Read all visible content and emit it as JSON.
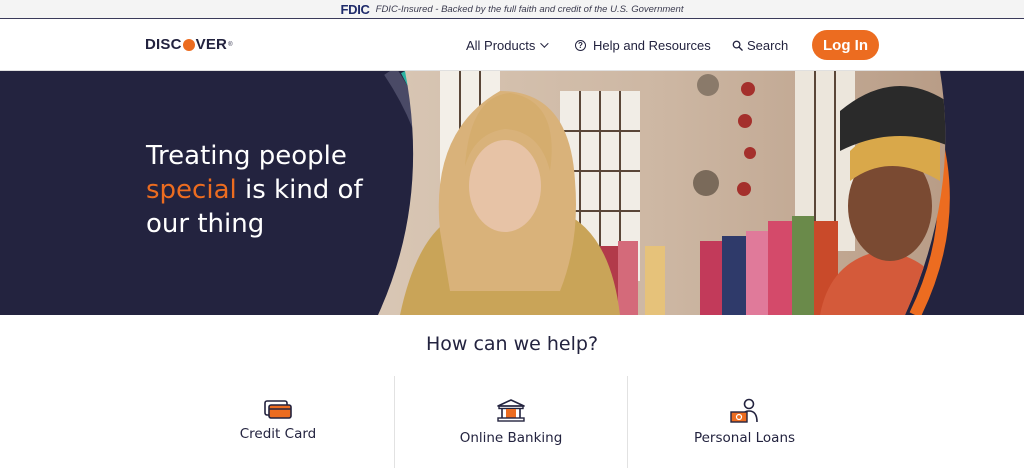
{
  "fdic_bar": {
    "logo": "FDIC",
    "text": "FDIC-Insured - Backed by the full faith and credit of the U.S. Government"
  },
  "header": {
    "logo_text_before": "DISC",
    "logo_text_after": "VER",
    "nav": {
      "products_label": "All Products",
      "help_label": "Help and Resources",
      "search_label": "Search"
    },
    "login_label": "Log In"
  },
  "hero": {
    "headline_line1": "Treating people",
    "headline_accent": "special",
    "headline_line2_rest": " is kind of",
    "headline_line3": "our thing"
  },
  "help_section": {
    "title": "How can we help?",
    "tiles": [
      {
        "label": "Credit Card",
        "icon": "credit-card-icon"
      },
      {
        "label": "Online Banking",
        "icon": "bank-icon"
      },
      {
        "label": "Personal Loans",
        "icon": "personal-loan-icon"
      }
    ]
  },
  "colors": {
    "brand_orange": "#ec6c20",
    "navy": "#23233f",
    "teal_arc": "#2bb3a3"
  }
}
